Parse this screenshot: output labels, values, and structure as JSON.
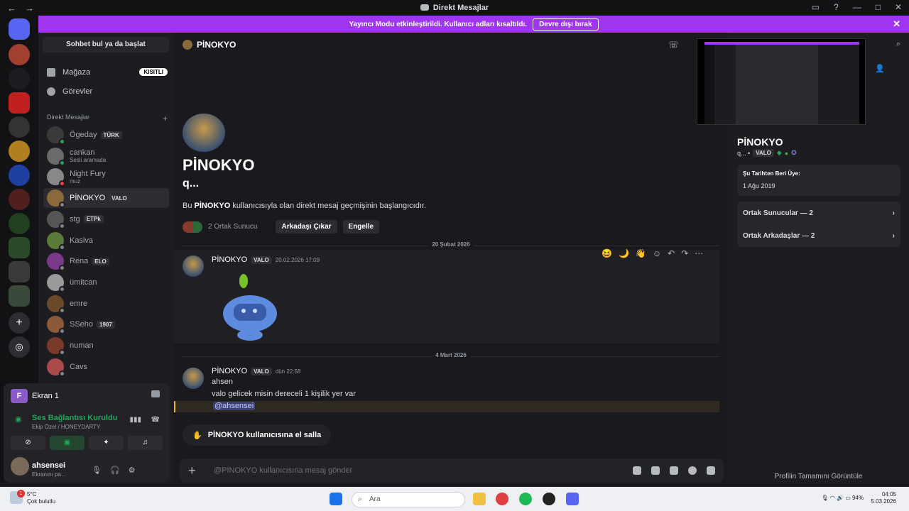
{
  "window": {
    "title": "Direkt Mesajlar"
  },
  "banner": {
    "text": "Yayıncı Modu etkinleştirildi. Kullanıcı adları kısaltıldı.",
    "button": "Devre dışı bırak"
  },
  "sidebar": {
    "search": "Sohbet bul ya da başlat",
    "store": "Mağaza",
    "store_badge": "KISITLI",
    "quests": "Görevler",
    "dm_header": "Direkt Mesajlar",
    "dms": [
      {
        "name": "Ögeday",
        "tag": "TÜRK",
        "sub": "",
        "color": "#3a3a3a",
        "status": "#23a55a"
      },
      {
        "name": "cankan",
        "tag": "",
        "sub": "Sesli aramada",
        "color": "#6a6a6a",
        "status": "#23a55a"
      },
      {
        "name": "Night Fury",
        "tag": "",
        "sub": "muz",
        "color": "#888",
        "status": "#f23f43"
      },
      {
        "name": "PİNOKYO",
        "tag": "VALO",
        "sub": "",
        "color": "#8a6a3a",
        "status": "#80848e"
      },
      {
        "name": "stg",
        "tag": "ETPk",
        "sub": "",
        "color": "#555",
        "status": "#80848e"
      },
      {
        "name": "Kasiva",
        "tag": "",
        "sub": "",
        "color": "#5a7a3a",
        "status": "#80848e"
      },
      {
        "name": "Rena",
        "tag": "ELO",
        "sub": "",
        "color": "#7a3a8a",
        "status": "#80848e"
      },
      {
        "name": "ümitcan",
        "tag": "",
        "sub": "",
        "color": "#999",
        "status": "#80848e"
      },
      {
        "name": "emre",
        "tag": "",
        "sub": "",
        "color": "#6a4a2a",
        "status": "#80848e"
      },
      {
        "name": "SSeho",
        "tag": "1907",
        "sub": "",
        "color": "#8a5a3a",
        "status": "#80848e"
      },
      {
        "name": "numan",
        "tag": "",
        "sub": "",
        "color": "#7a3a2a",
        "status": "#80848e"
      },
      {
        "name": "Cavs",
        "tag": "",
        "sub": "",
        "color": "#aa4a4a",
        "status": "#80848e"
      }
    ]
  },
  "screen_share": {
    "label": "Ekran 1",
    "icon_letter": "F"
  },
  "voice": {
    "status": "Ses Bağlantısı Kuruldu",
    "channel": "Ekip Özel / HONEYDARTY"
  },
  "user": {
    "name": "ahsensei",
    "status": "Ekranını pa..."
  },
  "chat": {
    "header_name": "PİNOKYO",
    "profile_name": "PİNOKYO",
    "profile_sub": "q...",
    "intro_prefix": "Bu",
    "intro_name": "PİNOKYO",
    "intro_suffix": "kullanıcısıyla olan direkt mesaj geçmişinin başlangıcıdır.",
    "mutual_servers": "2 Ortak Sunucu",
    "remove_friend": "Arkadaşı Çıkar",
    "block": "Engelle",
    "date1": "20 Şubat 2026",
    "date2": "4 Mart 2026",
    "msg1": {
      "author": "PİNOKYO",
      "tag": "VALO",
      "time": "20.02.2026 17:09"
    },
    "msg2": {
      "author": "PİNOKYO",
      "tag": "VALO",
      "time": "dün 22:58",
      "lines": [
        "ahsen",
        "valo gelicek misin dereceli 1 kişilik yer var"
      ],
      "mention": "@ahsensei"
    },
    "wave": "PİNOKYO kullanıcısına el salla",
    "composer_placeholder": "@PİNOKYO kullanıcısına mesaj gönder"
  },
  "profile": {
    "name": "PİNOKYO",
    "sub": "q... •",
    "tag": "VALO",
    "member_since_label": "Şu Tarihten Beri Üye:",
    "member_since": "1 Ağu 2019",
    "mutual_servers": "Ortak Sunucular — 2",
    "mutual_friends": "Ortak Arkadaşlar — 2",
    "full_profile": "Profilin Tamamını Görüntüle"
  },
  "taskbar": {
    "weather_temp": "5°C",
    "weather_desc": "Çok bulutlu",
    "search": "Ara",
    "battery": "94%",
    "time": "04:05",
    "date": "5.03.2026",
    "notif_count": "1"
  },
  "colors": {
    "accent": "#a035f0",
    "discord": "#5865f2",
    "online": "#23a55a",
    "dnd": "#f23f43"
  }
}
